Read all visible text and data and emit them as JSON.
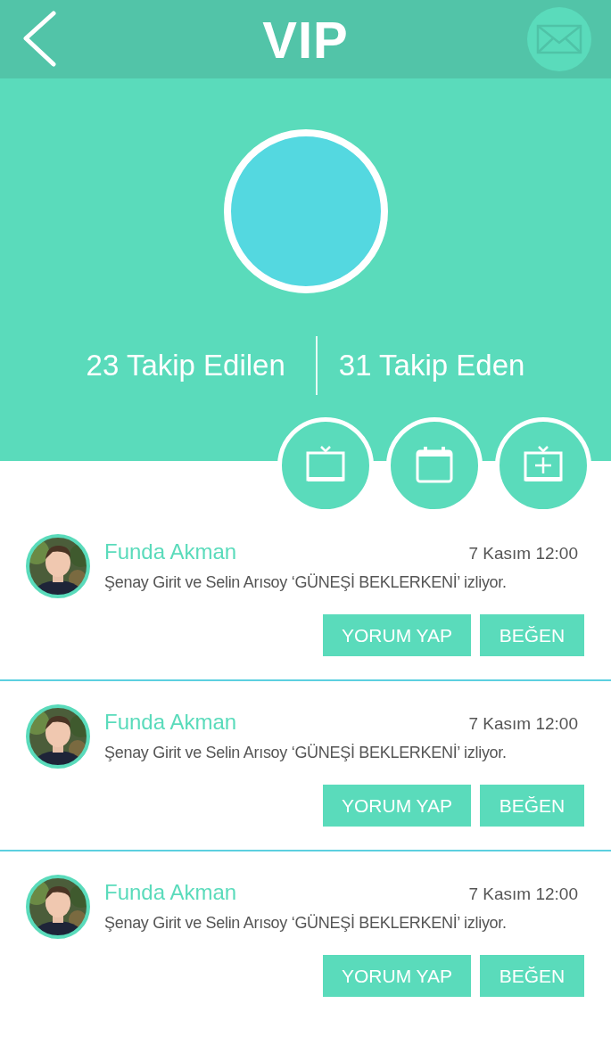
{
  "header": {
    "title": "VIP"
  },
  "profile": {
    "stats": [
      "23 Takip Edilen",
      "31 Takip Eden"
    ]
  },
  "feed": [
    {
      "name": "Funda Akman",
      "time": "7 Kasım 12:00",
      "text": "Şenay Girit ve Selin Arısoy ‘GÜNEŞİ BEKLERKENİ’ izliyor.",
      "buttons": [
        "YORUM YAP",
        "BEĞEN"
      ]
    },
    {
      "name": "Funda Akman",
      "time": "7 Kasım 12:00",
      "text": "Şenay Girit ve Selin Arısoy ‘GÜNEŞİ BEKLERKENİ’ izliyor.",
      "buttons": [
        "YORUM YAP",
        "BEĞEN"
      ]
    },
    {
      "name": "Funda Akman",
      "time": "7 Kasım 12:00",
      "text": "Şenay Girit ve Selin Arısoy ‘GÜNEŞİ BEKLERKENİ’ izliyor.",
      "buttons": [
        "YORUM YAP",
        "BEĞEN"
      ]
    }
  ]
}
